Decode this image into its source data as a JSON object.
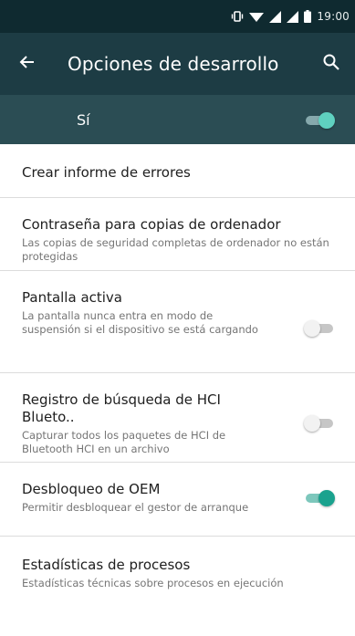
{
  "status_bar": {
    "time": "19:00",
    "icons": [
      "vibrate-icon",
      "wifi-icon",
      "signal-icon",
      "signal-icon",
      "battery-icon"
    ]
  },
  "app_bar": {
    "title": "Opciones de desarrollo",
    "back_icon": "arrow-back-icon",
    "search_icon": "search-icon"
  },
  "master_switch": {
    "label": "Sí",
    "state": "on"
  },
  "items": [
    {
      "title": "Crear informe de errores"
    },
    {
      "title": "Contraseña para copias de ordenador",
      "summary": "Las copias de seguridad completas de ordenador no están protegidas"
    },
    {
      "title": "Pantalla activa",
      "summary": "La pantalla nunca entra en modo de suspensión si el dispositivo se está cargando",
      "toggle": "off"
    },
    {
      "title": "Registro de búsqueda de HCI Blueto..",
      "summary": "Capturar todos los paquetes de HCI de Bluetooth HCI en un archivo",
      "toggle": "off"
    },
    {
      "title": "Desbloqueo de OEM",
      "summary": "Permitir desbloquear el gestor de arranque",
      "toggle": "on"
    },
    {
      "title": "Estadísticas de procesos",
      "summary": "Estadísticas técnicas sobre procesos en ejecución"
    }
  ],
  "colors": {
    "status_bar": "#0f2a30",
    "app_bar": "#1d3c44",
    "master_bar": "#2b4d54",
    "accent": "#1aa28e"
  }
}
